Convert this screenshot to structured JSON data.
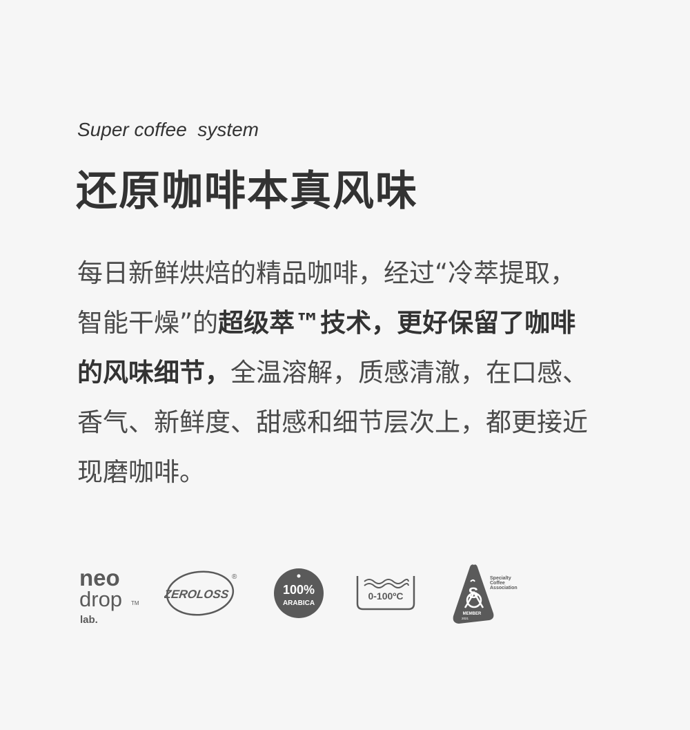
{
  "subtitle": "Super coffee  system",
  "headline": "还原咖啡本真风味",
  "body": {
    "line1": "每日新鲜烘焙的精品咖啡，经过“冷萃提取，",
    "line2_normal": "智能干燥”的",
    "line2_bold": "超级萃™技术，更好保留了咖啡",
    "line3_bold": "的风味细节，",
    "line3_normal": "全温溶解，质感清澈，在口感、",
    "line4": "香气、新鲜度、甜感和细节层次上，都更接近",
    "line5": "现磨咖啡。"
  },
  "logos": {
    "neodrop": {
      "line1": "neo",
      "line2": "drop",
      "tm": "TM",
      "line3": "lab."
    },
    "zeroloss": {
      "text": "ZEROLOSS",
      "reg": "®"
    },
    "arabica": {
      "pct": "100%",
      "text": "ARABICA"
    },
    "temperature": {
      "text": "0-100ºC"
    },
    "sca": {
      "line1": "Specialty",
      "line2": "Coffee",
      "line3": "Association",
      "member": "MEMBER",
      "year": "2021"
    }
  },
  "colors": {
    "background": "#f6f6f6",
    "text": "#4a4a4a",
    "logo": "#5a5a5a"
  }
}
